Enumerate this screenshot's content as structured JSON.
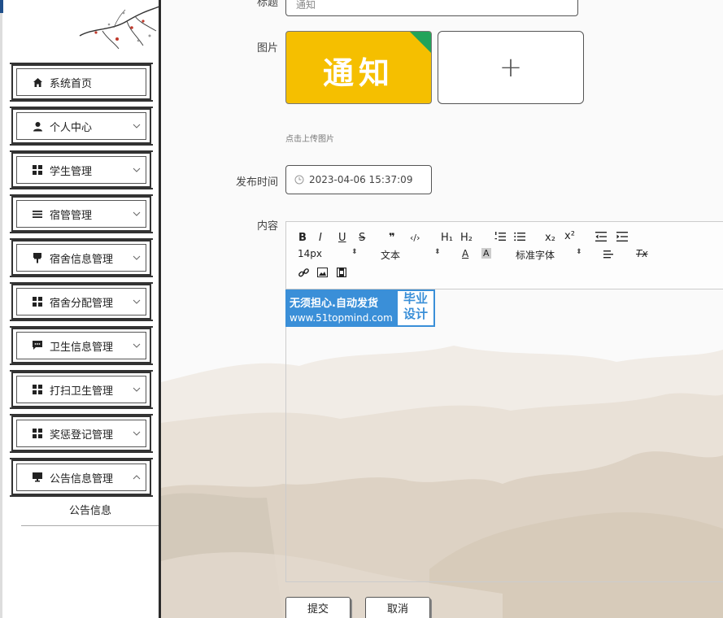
{
  "sidebar": {
    "items": [
      {
        "label": "系统首页",
        "icon": "home-icon",
        "has_chevron": false
      },
      {
        "label": "个人中心",
        "icon": "user-icon",
        "chevron": "down"
      },
      {
        "label": "学生管理",
        "icon": "grid-icon",
        "chevron": "down"
      },
      {
        "label": "宿管管理",
        "icon": "list-icon",
        "chevron": "down"
      },
      {
        "label": "宿舍信息管理",
        "icon": "brush-icon",
        "chevron": "down"
      },
      {
        "label": "宿舍分配管理",
        "icon": "grid-icon",
        "chevron": "down"
      },
      {
        "label": "卫生信息管理",
        "icon": "chat-icon",
        "chevron": "down"
      },
      {
        "label": "打扫卫生管理",
        "icon": "grid-icon",
        "chevron": "down"
      },
      {
        "label": "奖惩登记管理",
        "icon": "grid-icon",
        "chevron": "down"
      },
      {
        "label": "公告信息管理",
        "icon": "monitor-icon",
        "chevron": "up"
      }
    ],
    "submenu": {
      "label": "公告信息"
    }
  },
  "form": {
    "title_label": "标题",
    "title_value": "通知",
    "image_label": "图片",
    "image_thumb_text": "通知",
    "upload_plus": "+",
    "upload_hint": "点击上传图片",
    "date_label": "发布时间",
    "date_value": "2023-04-06 15:37:09",
    "content_label": "内容"
  },
  "editor": {
    "toolbar": {
      "bold": "B",
      "italic": "I",
      "underline": "U",
      "strike": "S",
      "quote": "❞",
      "code": "‹/›",
      "h1": "H₁",
      "h2": "H₂",
      "sub": "x₂",
      "sup": "x²",
      "font_size": "14px",
      "text_style": "文本",
      "font_family": "标准字体",
      "clear": "Tx"
    },
    "banner": {
      "line1": "无须担心.自动发货",
      "line2": "www.51topmind.com",
      "right_line1": "毕业",
      "right_line2": "设计"
    }
  },
  "buttons": {
    "submit": "提交",
    "cancel": "取消"
  },
  "colors": {
    "accent": "#3a8fd8",
    "thumb_bg": "#f5bf00",
    "thumb_corner": "#22a35a"
  }
}
